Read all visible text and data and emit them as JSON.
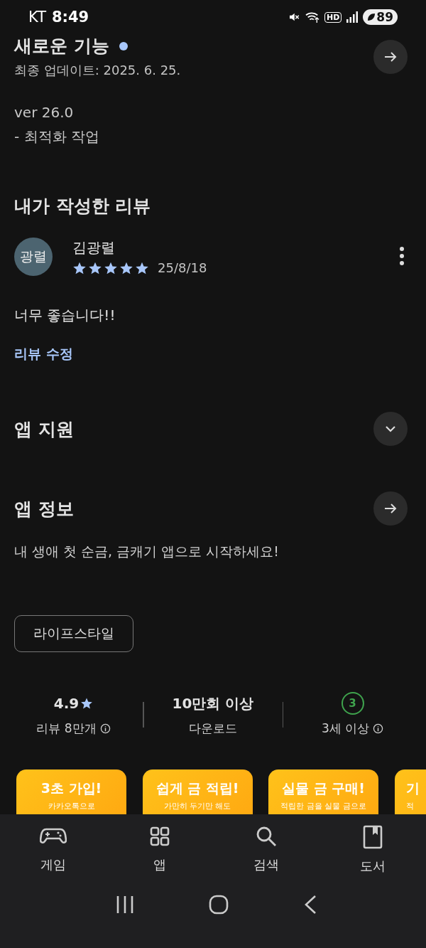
{
  "status_bar": {
    "carrier": "KT",
    "time": "8:49",
    "network_badge": "HD",
    "battery": "89"
  },
  "whats_new": {
    "title": "새로운 기능",
    "unread_dot": true,
    "updated": "최종 업데이트: 2025. 6. 25.",
    "notes": [
      "ver 26.0",
      "- 최적화 작업"
    ]
  },
  "my_review": {
    "heading": "내가 작성한 리뷰",
    "avatar": "광렬",
    "author": "김광렬",
    "stars": 5,
    "date": "25/8/18",
    "text": "너무 좋습니다!!",
    "edit_link": "리뷰 수정"
  },
  "app_support": {
    "title": "앱 지원",
    "expanded": false
  },
  "app_info": {
    "title": "앱 정보",
    "description": "내 생애 첫 순금, 금캐기 앱으로 시작하세요!",
    "category": "라이프스타일"
  },
  "stats": [
    {
      "kind": "rating",
      "value": "4.9",
      "label": "리뷰 8만개"
    },
    {
      "kind": "downloads",
      "value": "10만회 이상",
      "label": "다운로드"
    },
    {
      "kind": "age",
      "value": "3",
      "label": "3세 이상"
    }
  ],
  "screenshots": [
    {
      "title": "3초 가입!",
      "caption": "카카오톡으로"
    },
    {
      "title": "쉽게 금 적립!",
      "caption": "가만히 두기만 해도"
    },
    {
      "title": "실물 금 구매!",
      "caption": "적립한 금을 실물 금으로"
    },
    {
      "title": "기",
      "caption": "적"
    }
  ],
  "bottom_nav": [
    {
      "kind": "games",
      "label": "게임"
    },
    {
      "kind": "apps",
      "label": "앱"
    },
    {
      "kind": "search",
      "label": "검색"
    },
    {
      "kind": "books",
      "label": "도서"
    }
  ]
}
